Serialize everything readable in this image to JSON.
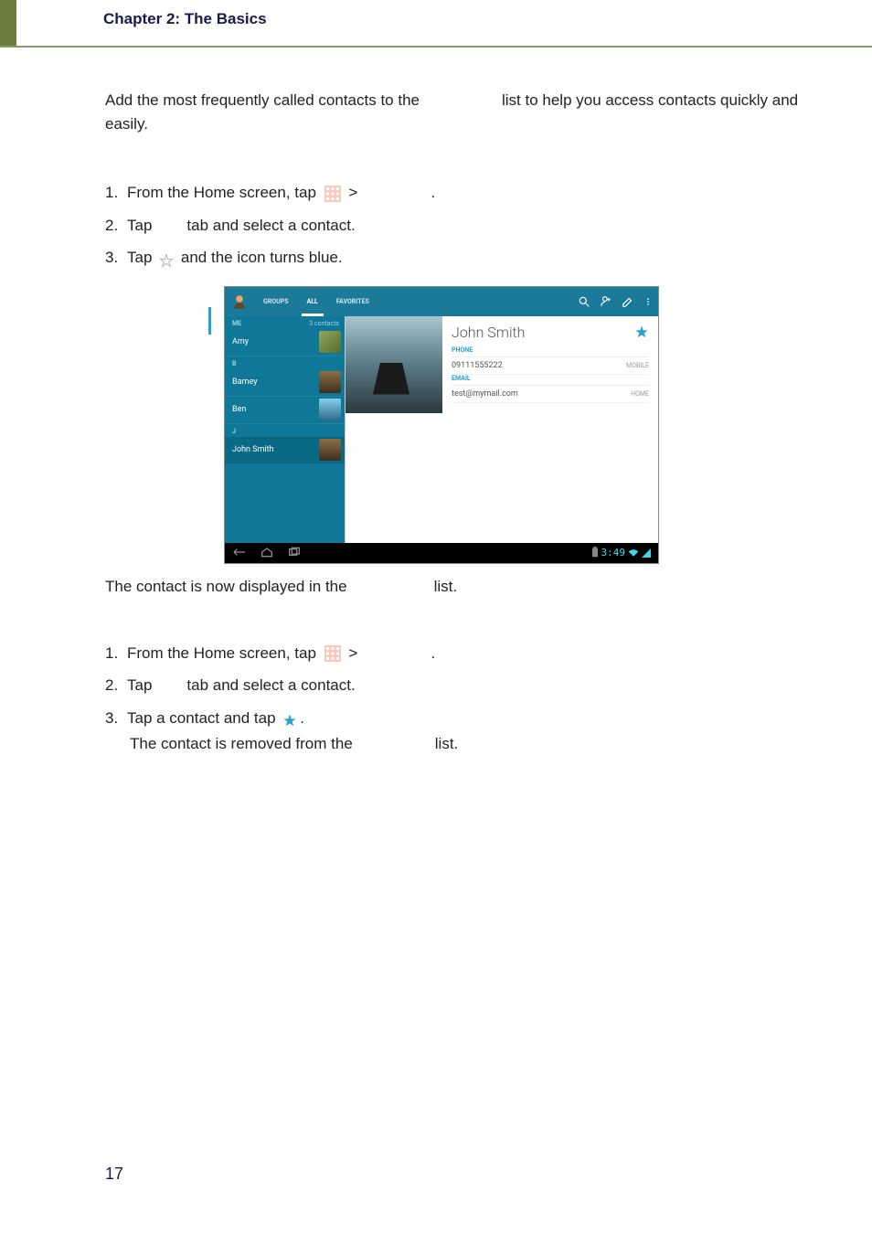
{
  "header": {
    "chapter_title": "Chapter 2: The Basics"
  },
  "intro": {
    "part1": "Add the most frequently called contacts to the",
    "part2": "list to help you access contacts quickly and easily."
  },
  "steps_add": {
    "s1a": "From the Home screen, tap",
    "s1b": ">",
    "s1c": ".",
    "s2a": "Tap",
    "s2b": "tab and select a contact.",
    "s3a": "Tap",
    "s3b": "and the icon turns blue."
  },
  "after_add": {
    "part1": "The contact is now displayed in the",
    "part2": "list."
  },
  "steps_remove": {
    "s1a": "From the Home screen, tap",
    "s1b": ">",
    "s1c": ".",
    "s2a": "Tap",
    "s2b": "tab and select a contact.",
    "s3a": "Tap a contact and tap",
    "s3b": ".",
    "s4a": "The contact is removed from the",
    "s4b": "list."
  },
  "screenshot": {
    "tabs": {
      "groups": "GROUPS",
      "all": "ALL",
      "favorites": "FAVORITES"
    },
    "me_label": "ME",
    "contacts_count": "3 contacts",
    "list": {
      "amy": "Amy",
      "header_b": "B",
      "barney": "Barney",
      "ben": "Ben",
      "header_j": "J",
      "john": "John Smith"
    },
    "detail": {
      "name": "John Smith",
      "phone_label": "PHONE",
      "phone_value": "09111555222",
      "phone_type": "MOBILE",
      "email_label": "EMAIL",
      "email_value": "test@mymail.com",
      "email_type": "HOME"
    },
    "time": "3:49"
  },
  "page_number": "17"
}
